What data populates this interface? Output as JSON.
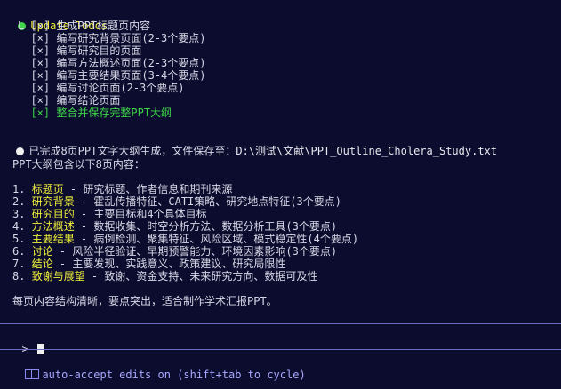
{
  "todos": {
    "title": "Update Todos",
    "branch": "L",
    "items": [
      {
        "mark": "[×]",
        "text": "生成PPT标题页内容"
      },
      {
        "mark": "[×]",
        "text": "编写研究背景页面(2-3个要点)"
      },
      {
        "mark": "[×]",
        "text": "编写研究目的页面"
      },
      {
        "mark": "[×]",
        "text": "编写方法概述页面(2-3个要点)"
      },
      {
        "mark": "[×]",
        "text": "编写主要结果页面(3-4个要点)"
      },
      {
        "mark": "[×]",
        "text": "编写讨论页面(2-3个要点)"
      },
      {
        "mark": "[×]",
        "text": "编写结论页面"
      },
      {
        "mark": "[×]",
        "text": "整合并保存完整PPT大纲"
      }
    ]
  },
  "result": {
    "message": "已完成8页PPT文字大纲生成，文件保存至：",
    "path": "D:\\测试\\文献\\PPT_Outline_Cholera_Study.txt"
  },
  "outline": {
    "intro": "PPT大纲包含以下8页内容：",
    "items": [
      {
        "num": "1.",
        "title": "标题页",
        "desc": " - 研究标题、作者信息和期刊来源"
      },
      {
        "num": "2.",
        "title": "研究背景",
        "desc": " - 霍乱传播特征、CATI策略、研究地点特征(3个要点)"
      },
      {
        "num": "3.",
        "title": "研究目的",
        "desc": " - 主要目标和4个具体目标"
      },
      {
        "num": "4.",
        "title": "方法概述",
        "desc": " - 数据收集、时空分析方法、数据分析工具(3个要点)"
      },
      {
        "num": "5.",
        "title": "主要结果",
        "desc": " - 病例检测、聚集特征、风险区域、模式稳定性(4个要点)"
      },
      {
        "num": "6.",
        "title": "讨论",
        "desc": " - 风险半径验证、早期预警能力、环境因素影响(3个要点)"
      },
      {
        "num": "7.",
        "title": "结论",
        "desc": " - 主要发现、实践意义、政策建议、研究局限性"
      },
      {
        "num": "8.",
        "title": "致谢与展望",
        "desc": " - 致谢、资金支持、未来研究方向、数据可及性"
      }
    ],
    "summary": "每页内容结构清晰，要点突出，适合制作学术汇报PPT。"
  },
  "prompt": {
    "symbol": ">"
  },
  "footer": {
    "mode_text": "auto-accept edits on",
    "hint": " (shift+tab to cycle)"
  },
  "colors": {
    "background": "#0c0c2e",
    "highlight": "#f0f03a",
    "success": "#3fd34a",
    "mode": "#a8a8ff"
  }
}
